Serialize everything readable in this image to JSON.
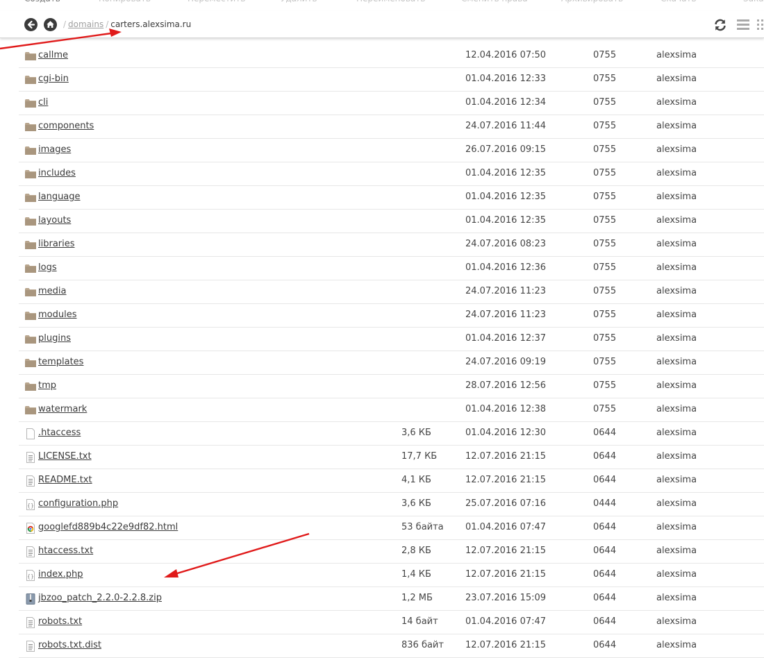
{
  "top_menu": [
    "Создать",
    "Копировать",
    "Переместить",
    "Удалить",
    "Переименовать",
    "Сменить права",
    "Архивировать",
    "Скачать",
    "Закачать"
  ],
  "breadcrumb": {
    "separator": "/",
    "parent": "domains",
    "current": "carters.alexsima.ru"
  },
  "colors": {
    "arrow": "#e01a1a",
    "folder": "#b9a68e",
    "text": "#3a3a3a"
  },
  "files": [
    {
      "name": "callme",
      "type": "folder-icon",
      "size": "",
      "date": "12.04.2016 07:50",
      "perm": "0755",
      "owner": "alexsima"
    },
    {
      "name": "cgi-bin",
      "type": "folder-icon",
      "size": "",
      "date": "01.04.2016 12:33",
      "perm": "0755",
      "owner": "alexsima"
    },
    {
      "name": "cli",
      "type": "folder-icon",
      "size": "",
      "date": "01.04.2016 12:34",
      "perm": "0755",
      "owner": "alexsima"
    },
    {
      "name": "components",
      "type": "folder-icon",
      "size": "",
      "date": "24.07.2016 11:44",
      "perm": "0755",
      "owner": "alexsima"
    },
    {
      "name": "images",
      "type": "folder-icon",
      "size": "",
      "date": "26.07.2016 09:15",
      "perm": "0755",
      "owner": "alexsima"
    },
    {
      "name": "includes",
      "type": "folder-icon",
      "size": "",
      "date": "01.04.2016 12:35",
      "perm": "0755",
      "owner": "alexsima"
    },
    {
      "name": "language",
      "type": "folder-icon",
      "size": "",
      "date": "01.04.2016 12:35",
      "perm": "0755",
      "owner": "alexsima"
    },
    {
      "name": "layouts",
      "type": "folder-icon",
      "size": "",
      "date": "01.04.2016 12:35",
      "perm": "0755",
      "owner": "alexsima"
    },
    {
      "name": "libraries",
      "type": "folder-icon",
      "size": "",
      "date": "24.07.2016 08:23",
      "perm": "0755",
      "owner": "alexsima"
    },
    {
      "name": "logs",
      "type": "folder-icon",
      "size": "",
      "date": "01.04.2016 12:36",
      "perm": "0755",
      "owner": "alexsima"
    },
    {
      "name": "media",
      "type": "folder-icon",
      "size": "",
      "date": "24.07.2016 11:23",
      "perm": "0755",
      "owner": "alexsima"
    },
    {
      "name": "modules",
      "type": "folder-icon",
      "size": "",
      "date": "24.07.2016 11:23",
      "perm": "0755",
      "owner": "alexsima"
    },
    {
      "name": "plugins",
      "type": "folder-icon",
      "size": "",
      "date": "01.04.2016 12:37",
      "perm": "0755",
      "owner": "alexsima"
    },
    {
      "name": "templates",
      "type": "folder-icon",
      "size": "",
      "date": "24.07.2016 09:19",
      "perm": "0755",
      "owner": "alexsima"
    },
    {
      "name": "tmp",
      "type": "folder-icon",
      "size": "",
      "date": "28.07.2016 12:56",
      "perm": "0755",
      "owner": "alexsima"
    },
    {
      "name": "watermark",
      "type": "folder-icon",
      "size": "",
      "date": "01.04.2016 12:38",
      "perm": "0755",
      "owner": "alexsima"
    },
    {
      "name": ".htaccess",
      "type": "blank-file-icon",
      "size": "3,6 КБ",
      "date": "01.04.2016 12:30",
      "perm": "0644",
      "owner": "alexsima"
    },
    {
      "name": "LICENSE.txt",
      "type": "text-file-icon",
      "size": "17,7 КБ",
      "date": "12.07.2016 21:15",
      "perm": "0644",
      "owner": "alexsima"
    },
    {
      "name": "README.txt",
      "type": "text-file-icon",
      "size": "4,1 КБ",
      "date": "12.07.2016 21:15",
      "perm": "0644",
      "owner": "alexsima"
    },
    {
      "name": "configuration.php",
      "type": "code-file-icon",
      "size": "3,6 КБ",
      "date": "25.07.2016 07:16",
      "perm": "0444",
      "owner": "alexsima"
    },
    {
      "name": "googlefd889b4c22e9df82.html",
      "type": "html-file-icon",
      "size": "53 байта",
      "date": "01.04.2016 07:47",
      "perm": "0644",
      "owner": "alexsima"
    },
    {
      "name": "htaccess.txt",
      "type": "text-file-icon",
      "size": "2,8 КБ",
      "date": "12.07.2016 21:15",
      "perm": "0644",
      "owner": "alexsima"
    },
    {
      "name": "index.php",
      "type": "code-file-icon",
      "size": "1,4 КБ",
      "date": "12.07.2016 21:15",
      "perm": "0644",
      "owner": "alexsima"
    },
    {
      "name": "jbzoo_patch_2.2.0-2.2.8.zip",
      "type": "zip-file-icon",
      "size": "1,2 МБ",
      "date": "23.07.2016 15:09",
      "perm": "0644",
      "owner": "alexsima"
    },
    {
      "name": "robots.txt",
      "type": "text-file-icon",
      "size": "14 байт",
      "date": "01.04.2016 07:47",
      "perm": "0644",
      "owner": "alexsima"
    },
    {
      "name": "robots.txt.dist",
      "type": "text-file-icon",
      "size": "836 байт",
      "date": "12.07.2016 21:15",
      "perm": "0644",
      "owner": "alexsima"
    }
  ]
}
